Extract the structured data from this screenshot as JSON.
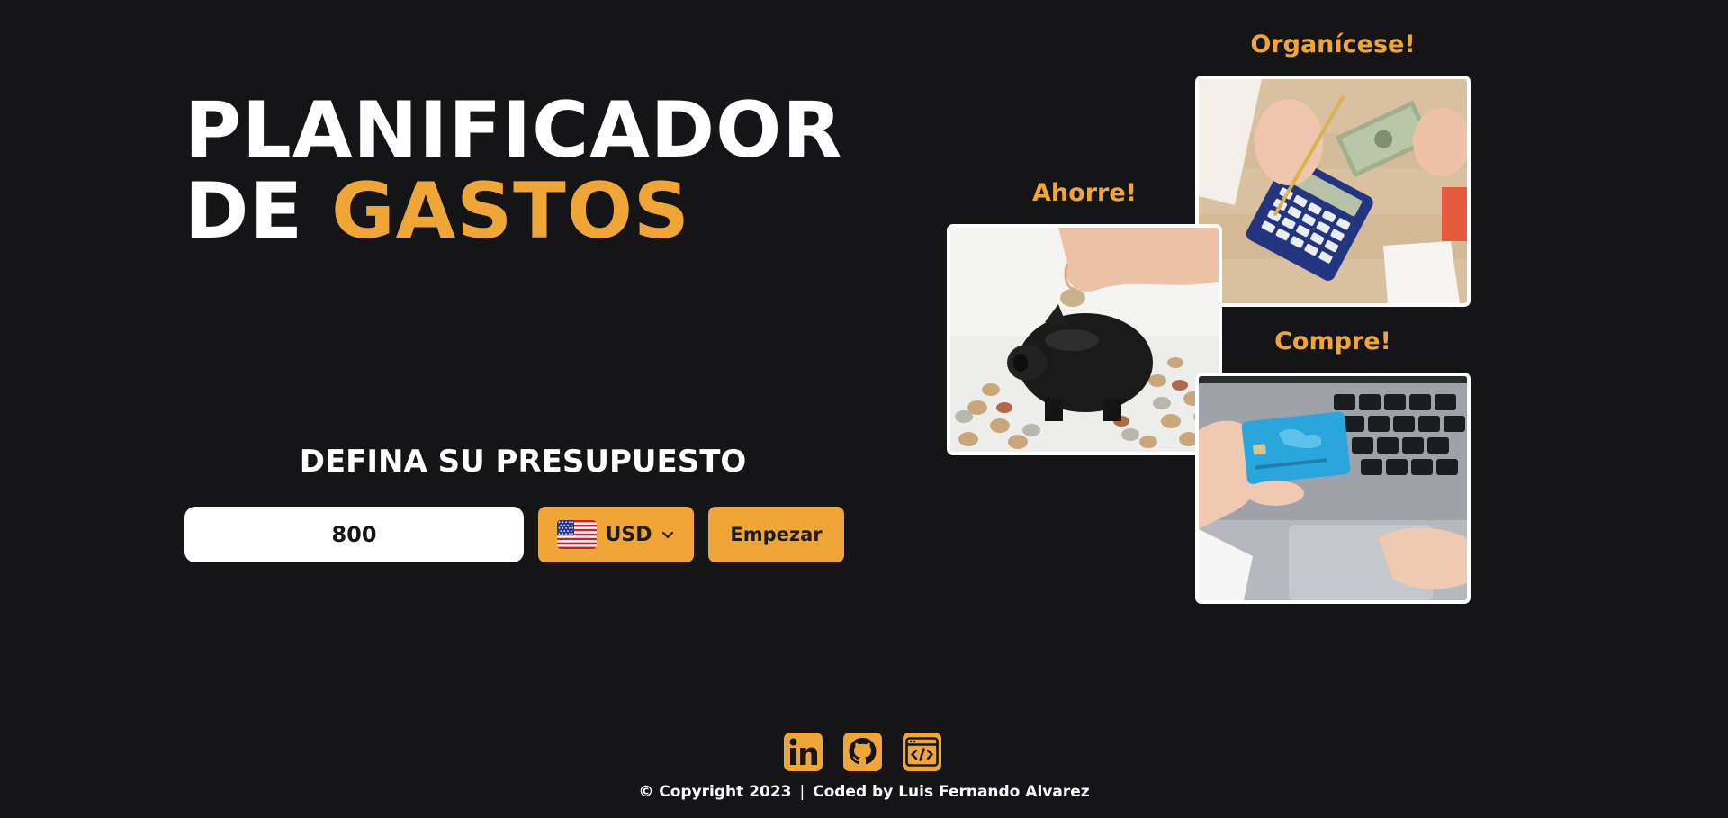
{
  "hero": {
    "title_line1": "PLANIFICADOR",
    "title_line2_prefix": "DE ",
    "title_line2_accent": "GASTOS"
  },
  "budget": {
    "heading": "DEFINA SU PRESUPUESTO",
    "amount_value": "800",
    "currency_selected": "USD",
    "currency_flag_icon": "us-flag-icon",
    "start_label": "Empezar"
  },
  "cards": [
    {
      "caption": "Organícese!",
      "image": "hands-calculator-money-photo"
    },
    {
      "caption": "Ahorre!",
      "image": "piggy-bank-coins-photo"
    },
    {
      "caption": "Compre!",
      "image": "credit-card-laptop-photo"
    }
  ],
  "footer": {
    "social_icons": [
      "linkedin-icon",
      "github-icon",
      "portfolio-code-icon"
    ],
    "copyright": "© Copyright 2023",
    "separator": "|",
    "credit": "Coded by Luis Fernando Alvarez"
  },
  "colors": {
    "background": "#151416",
    "accent": "#f0a636",
    "text": "#ffffff"
  }
}
